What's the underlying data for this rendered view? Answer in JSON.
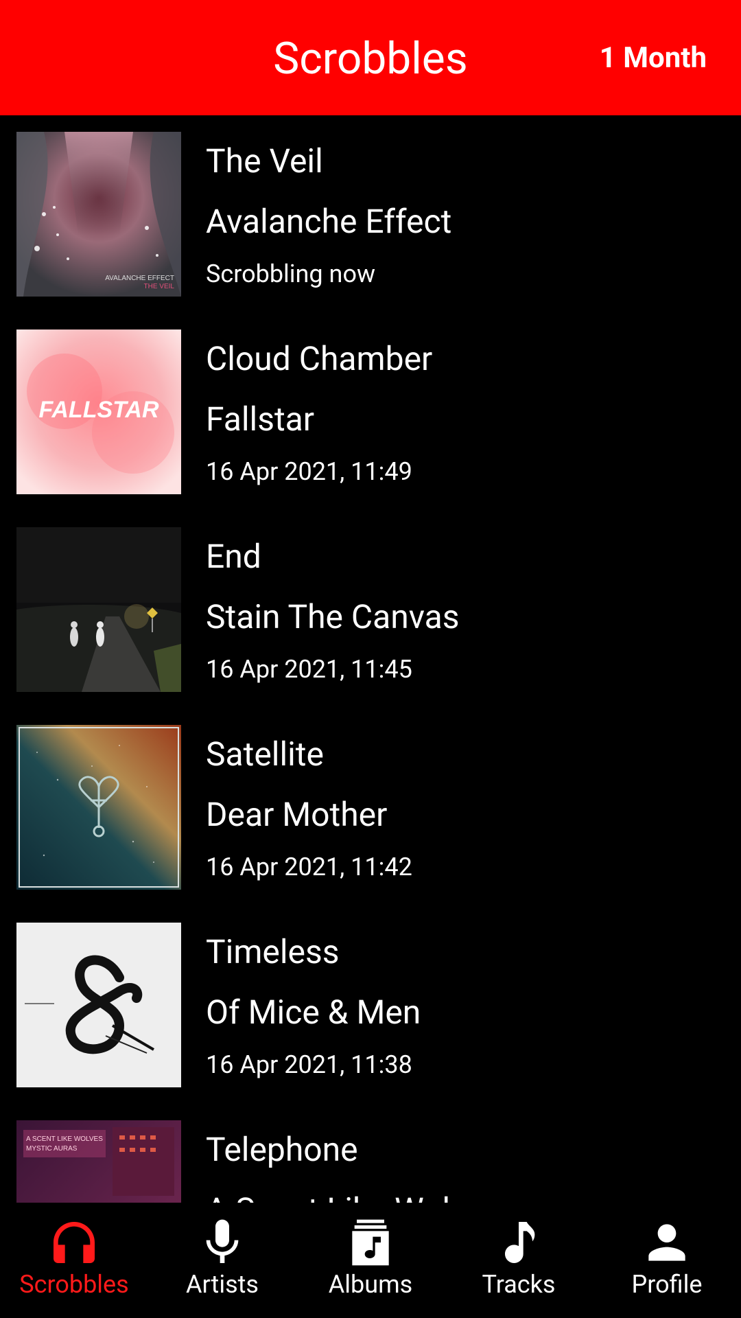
{
  "header": {
    "title": "Scrobbles",
    "period": "1 Month",
    "accent_color": "#ff0000"
  },
  "scrobbles": [
    {
      "track": "The Veil",
      "artist": "Avalanche Effect",
      "time": "Scrobbling now",
      "cover_text": "AVALANCHE EFFECT",
      "cover_subtext": "THE VEIL"
    },
    {
      "track": "Cloud Chamber",
      "artist": "Fallstar",
      "time": "16 Apr 2021, 11:49",
      "cover_text": "FALLSTAR"
    },
    {
      "track": "End",
      "artist": "Stain The Canvas",
      "time": "16 Apr 2021, 11:45"
    },
    {
      "track": "Satellite",
      "artist": "Dear Mother",
      "time": "16 Apr 2021, 11:42"
    },
    {
      "track": "Timeless",
      "artist": "Of Mice & Men",
      "time": "16 Apr 2021, 11:38"
    },
    {
      "track": "Telephone",
      "artist": "A Scent Like Wolves",
      "time": "",
      "cover_text": "A SCENT LIKE WOLVES",
      "cover_subtext": "MYSTIC AURAS"
    }
  ],
  "nav": {
    "items": [
      {
        "label": "Scrobbles",
        "icon": "headphones-icon",
        "active": true
      },
      {
        "label": "Artists",
        "icon": "microphone-icon",
        "active": false
      },
      {
        "label": "Albums",
        "icon": "album-icon",
        "active": false
      },
      {
        "label": "Tracks",
        "icon": "music-note-icon",
        "active": false
      },
      {
        "label": "Profile",
        "icon": "person-icon",
        "active": false
      }
    ],
    "active_color": "#ff1a1a"
  }
}
